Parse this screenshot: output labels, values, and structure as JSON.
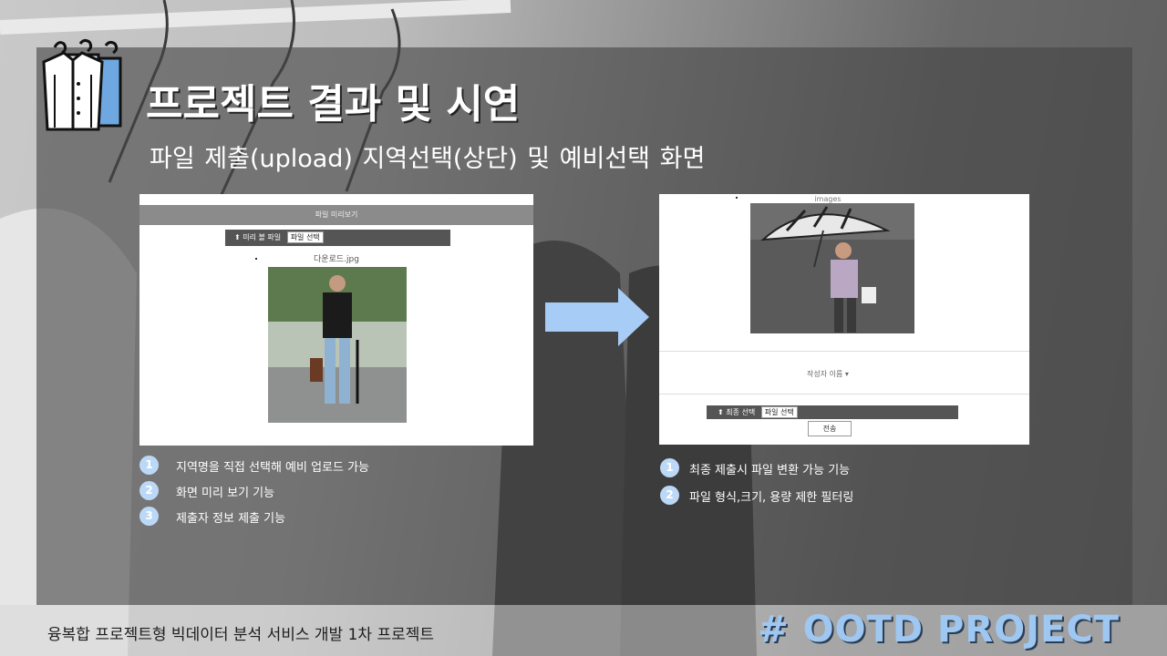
{
  "title": "프로젝트 결과 및 시연",
  "subtitle": "파일 제출(upload)    지역선택(상단) 및 예비선택 화면",
  "left_screen": {
    "header": "파일 미리보기",
    "upload_label": "미리 볼 파일",
    "file_button": "파일 선택",
    "filename": "다운로드.jpg"
  },
  "right_screen": {
    "images_label": "images",
    "author_label": "작성자 이름 ▾",
    "upload_label": "최종 선택",
    "file_button": "파일 선택",
    "submit_label": "전송"
  },
  "left_features": [
    {
      "num": "1",
      "text": "지역명을 직접 선택해 예비 업로드 가능"
    },
    {
      "num": "2",
      "text": "화면 미리 보기 기능"
    },
    {
      "num": "3",
      "text": "제출자 정보 제출 기능"
    }
  ],
  "right_features": [
    {
      "num": "1",
      "text": "최종 제출시 파일 변환 가능 기능"
    },
    {
      "num": "2",
      "text": "파일 형식,크기, 용량 제한 필터링"
    }
  ],
  "footer": {
    "course": "융복합 프로젝트형 빅데이터 분석 서비스 개발 1차 프로젝트",
    "brand": "# OOTD PROJECT"
  },
  "colors": {
    "accent": "#9ec7f2",
    "badge": "#bcd8f7",
    "panel": "#464646"
  },
  "icons": {
    "logo": "hanging-clothes-icon",
    "arrow": "right-arrow-icon",
    "upload": "upload-icon"
  }
}
